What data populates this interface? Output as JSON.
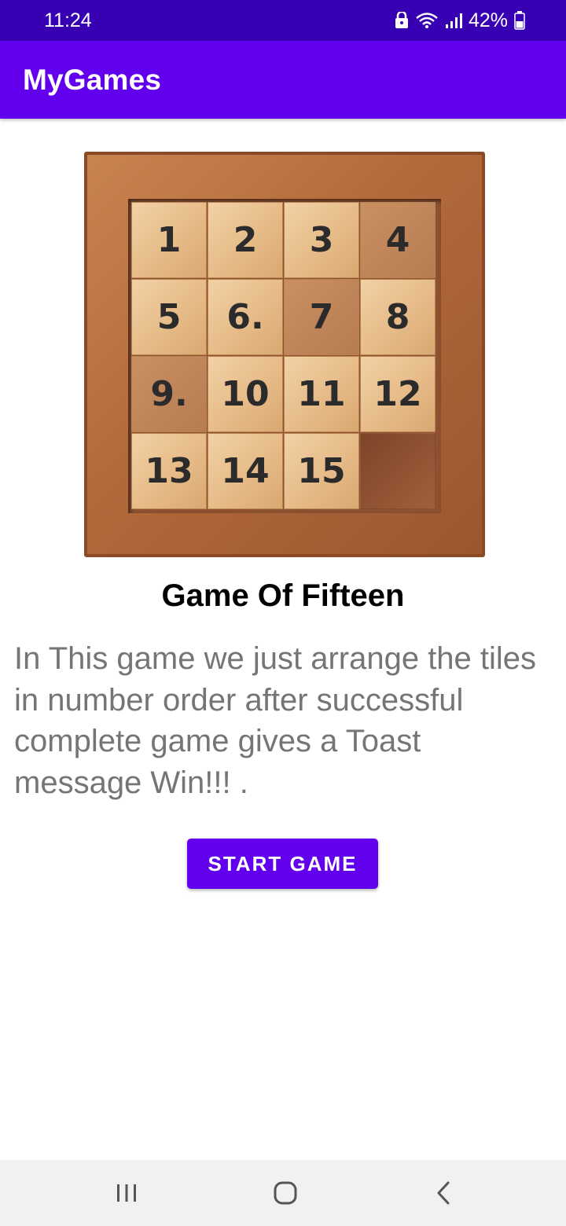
{
  "status_bar": {
    "time": "11:24",
    "battery": "42%",
    "icons": [
      "lock-icon",
      "wifi-icon",
      "signal-icon",
      "battery-icon"
    ]
  },
  "app_bar": {
    "title": "MyGames"
  },
  "puzzle_image": {
    "tiles": [
      "1",
      "2",
      "3",
      "4",
      "5",
      "6.",
      "7",
      "8",
      "9.",
      "10",
      "11",
      "12",
      "13",
      "14",
      "15",
      ""
    ]
  },
  "content": {
    "title": "Game Of Fifteen",
    "description": "In This game we just arrange the tiles in number order after successful complete game gives a Toast message Win!!! .",
    "start_button": "START GAME"
  },
  "nav_bar": {
    "icons": [
      "recents-icon",
      "home-icon",
      "back-icon"
    ]
  },
  "colors": {
    "status_bar": "#3700b3",
    "primary": "#6200ee",
    "text_secondary": "#757575"
  }
}
